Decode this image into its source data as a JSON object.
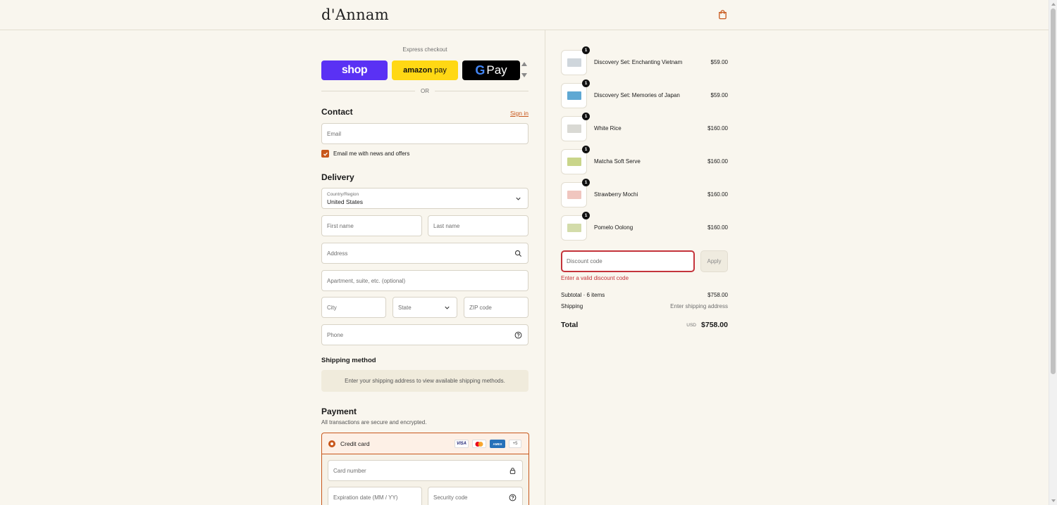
{
  "header": {
    "brand": "d'Annam"
  },
  "express": {
    "label": "Express checkout",
    "shop_label": "shop",
    "amazon_label": "amazon",
    "amazon_pay": "pay",
    "gpay_label": "Pay",
    "gpay_g": "G",
    "or_label": "OR"
  },
  "contact": {
    "title": "Contact",
    "sign_in": "Sign in",
    "email_placeholder": "Email",
    "newsletter_label": "Email me with news and offers",
    "newsletter_checked": true
  },
  "delivery": {
    "title": "Delivery",
    "country_label": "Country/Region",
    "country_value": "United States",
    "first_name": "First name",
    "last_name": "Last name",
    "address": "Address",
    "apartment": "Apartment, suite, etc. (optional)",
    "city": "City",
    "state": "State",
    "zip": "ZIP code",
    "phone": "Phone"
  },
  "shipping": {
    "title": "Shipping method",
    "message": "Enter your shipping address to view available shipping methods."
  },
  "payment": {
    "title": "Payment",
    "subtitle": "All transactions are secure and encrypted.",
    "method_label": "Credit card",
    "cards": [
      "VISA",
      "",
      "AMEX",
      "+5"
    ],
    "card_number": "Card number",
    "expiration": "Expiration date (MM / YY)",
    "security_code": "Security code"
  },
  "order": {
    "items": [
      {
        "name": "Discovery Set: Enchanting Vietnam",
        "price": "$59.00",
        "qty": "1"
      },
      {
        "name": "Discovery Set: Memories of Japan",
        "price": "$59.00",
        "qty": "1"
      },
      {
        "name": "White Rice",
        "price": "$160.00",
        "qty": "1"
      },
      {
        "name": "Matcha Soft Serve",
        "price": "$160.00",
        "qty": "1"
      },
      {
        "name": "Strawberry Mochi",
        "price": "$160.00",
        "qty": "1"
      },
      {
        "name": "Pomelo Oolong",
        "price": "$160.00",
        "qty": "1"
      }
    ],
    "discount_placeholder": "Discount code",
    "apply_label": "Apply",
    "discount_error": "Enter a valid discount code",
    "subtotal_label": "Subtotal · 6 items",
    "subtotal_value": "$758.00",
    "shipping_label": "Shipping",
    "shipping_value": "Enter shipping address",
    "total_label": "Total",
    "currency": "USD",
    "total_value": "$758.00"
  },
  "colors": {
    "accent": "#c8571b",
    "error": "#c4343b",
    "background": "#f9f6ee",
    "shop": "#5a31f4",
    "amazon": "#ffd814"
  }
}
